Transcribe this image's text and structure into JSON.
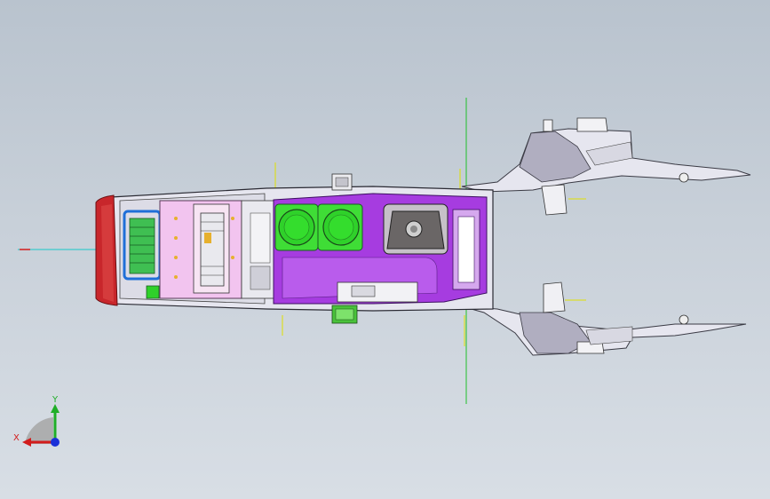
{
  "viewport": {
    "background_top": "#b9c3ce",
    "background_bottom": "#d8dee5"
  },
  "model": {
    "colors": {
      "tail_light": "#c8262b",
      "storage_bin": "#f2c4ef",
      "center_tray": "#a63ce0",
      "cup_holder": "#2fd12a",
      "shifter_boot": "#5a5a5a",
      "shell": "#e6e6ef",
      "bracket": "#cfcfd8",
      "axis_cyan": "#19c8c8",
      "axis_green": "#1fbf2a",
      "axis_yellow": "#e0e000"
    }
  },
  "triad": {
    "x_label": "X",
    "y_label": "Y",
    "x_color": "#d21c1c",
    "y_color": "#1fae27",
    "z_color": "#1a30d8"
  }
}
